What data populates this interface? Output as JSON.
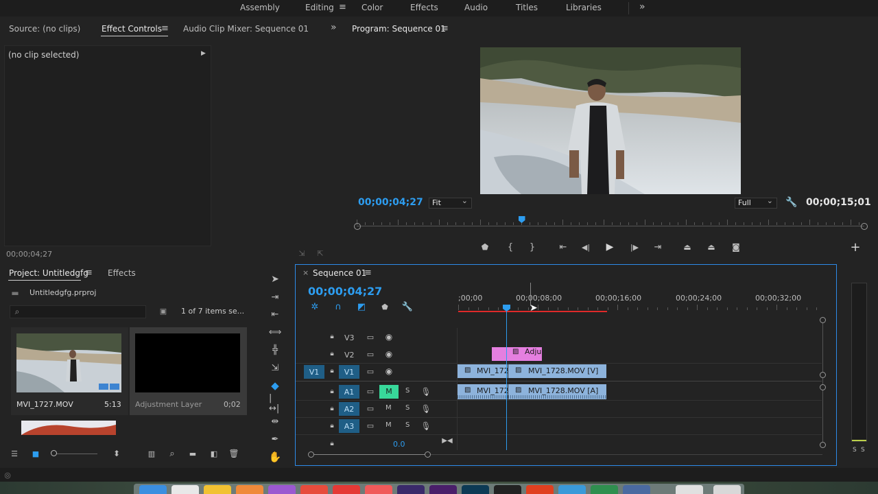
{
  "workspaces": {
    "items": [
      "Assembly",
      "Editing",
      "Color",
      "Effects",
      "Audio",
      "Titles",
      "Libraries"
    ],
    "active": "Editing",
    "overflow": "»"
  },
  "source_panel": {
    "tabs": [
      "Source: (no clips)",
      "Effect Controls",
      "Audio Clip Mixer: Sequence 01"
    ],
    "active_tab": "Effect Controls",
    "no_clip_text": "(no clip selected)",
    "timecode": "00;00;04;27"
  },
  "program_monitor": {
    "title": "Program: Sequence 01",
    "current_timecode": "00;00;04;27",
    "zoom_value": "Fit",
    "resolution_value": "Full",
    "duration_timecode": "00;00;15;01",
    "playhead_progress": 0.325
  },
  "project_panel": {
    "tabs": [
      "Project: Untitledgfg",
      "Effects"
    ],
    "active_tab": "Project: Untitledgfg",
    "project_file": "Untitledgfg.prproj",
    "items_count": "1 of 7 items se...",
    "items": [
      {
        "name": "MVI_1727.MOV",
        "duration": "5:13"
      },
      {
        "name": "Adjustment Layer",
        "duration": "0;02"
      }
    ]
  },
  "timeline": {
    "tab_label": "Sequence 01",
    "timecode": "00;00;04;27",
    "ruler_labels": [
      ";00;00",
      "00;00;08;00",
      "00;00;16;00",
      "00;00;24;00",
      "00;00;32;00"
    ],
    "video_tracks": [
      {
        "name": "V3",
        "source": ""
      },
      {
        "name": "V2",
        "source": ""
      },
      {
        "name": "V1",
        "source": "V1"
      }
    ],
    "audio_tracks": [
      {
        "name": "A1",
        "mute": "M",
        "solo": "S"
      },
      {
        "name": "A2",
        "mute": "M",
        "solo": "S"
      },
      {
        "name": "A3",
        "mute": "M",
        "solo": "S"
      }
    ],
    "clips": {
      "adjustment": "Adju",
      "v1_a": "MVI_172",
      "v1_b": "MVI_1728.MOV [V]",
      "a1_a": "MVI_172",
      "a1_b": "MVI_1728.MOV [A]"
    },
    "master_volume": "0.0"
  },
  "audio_meter": {
    "solo_labels": [
      "S",
      "S"
    ]
  },
  "colors": {
    "accent": "#2d9df0",
    "track_active": "#1f5e86",
    "video_clip": "#8db3dc",
    "adjustment_clip": "#e57fe0",
    "mute_active": "#38d89a",
    "work_area": "#e02a2a"
  }
}
